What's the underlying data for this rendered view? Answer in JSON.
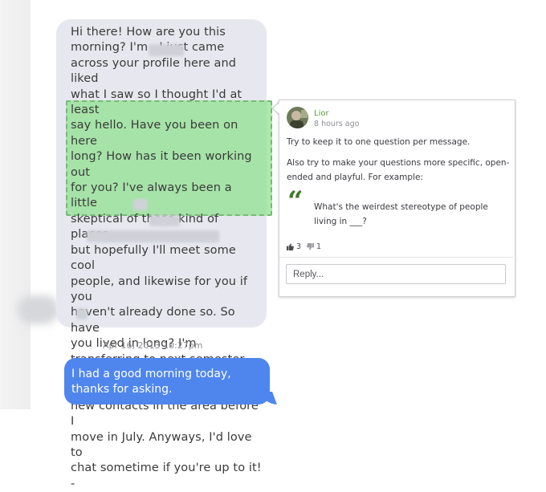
{
  "conversation": {
    "incoming_message": "Hi there! How are you this\nmorning? I'm         . I just came\nacross your profile here and liked\nwhat I saw so I thought I'd at least\nsay hello. Have you been on here\nlong? How has it been working out\nfor you? I've always been a little\nskeptical of these kind of places,\nbut hopefully I'll meet some cool\npeople, and likewise for you if you\nhaven't already done so. So have\nyou lived in      long? I'm\ntransferring to           next semester\nfor                                      Would\ndefinitely be nice to make some\nnew contacts in the area before I\nmove in July. Anyways, I'd love to\nchat sometime if you're up to it!\n-",
    "timestamp": "Apr 16, 2013 10:27pm",
    "outgoing_message": "I had a good morning today,\nthanks for asking."
  },
  "comment": {
    "author": "Lior",
    "time_ago": "8 hours ago",
    "paragraph_1": "Try to keep it to one question per message.",
    "paragraph_2_line_1": "Also try to make your questions more specific, open-",
    "paragraph_2_line_2": "ended and playful. For example:",
    "quote_mark": "“",
    "quote": "What's the weirdest stereotype of people\nliving in ___?",
    "upvotes": "3",
    "downvotes": "1",
    "reply_placeholder": "Reply...",
    "colors": {
      "author": "#5a9c3a",
      "quote_mark": "#3e7a27",
      "highlight": "#90e290"
    }
  },
  "icons": {
    "upvote": "thumbs-up-icon",
    "downvote": "thumbs-down-icon"
  }
}
